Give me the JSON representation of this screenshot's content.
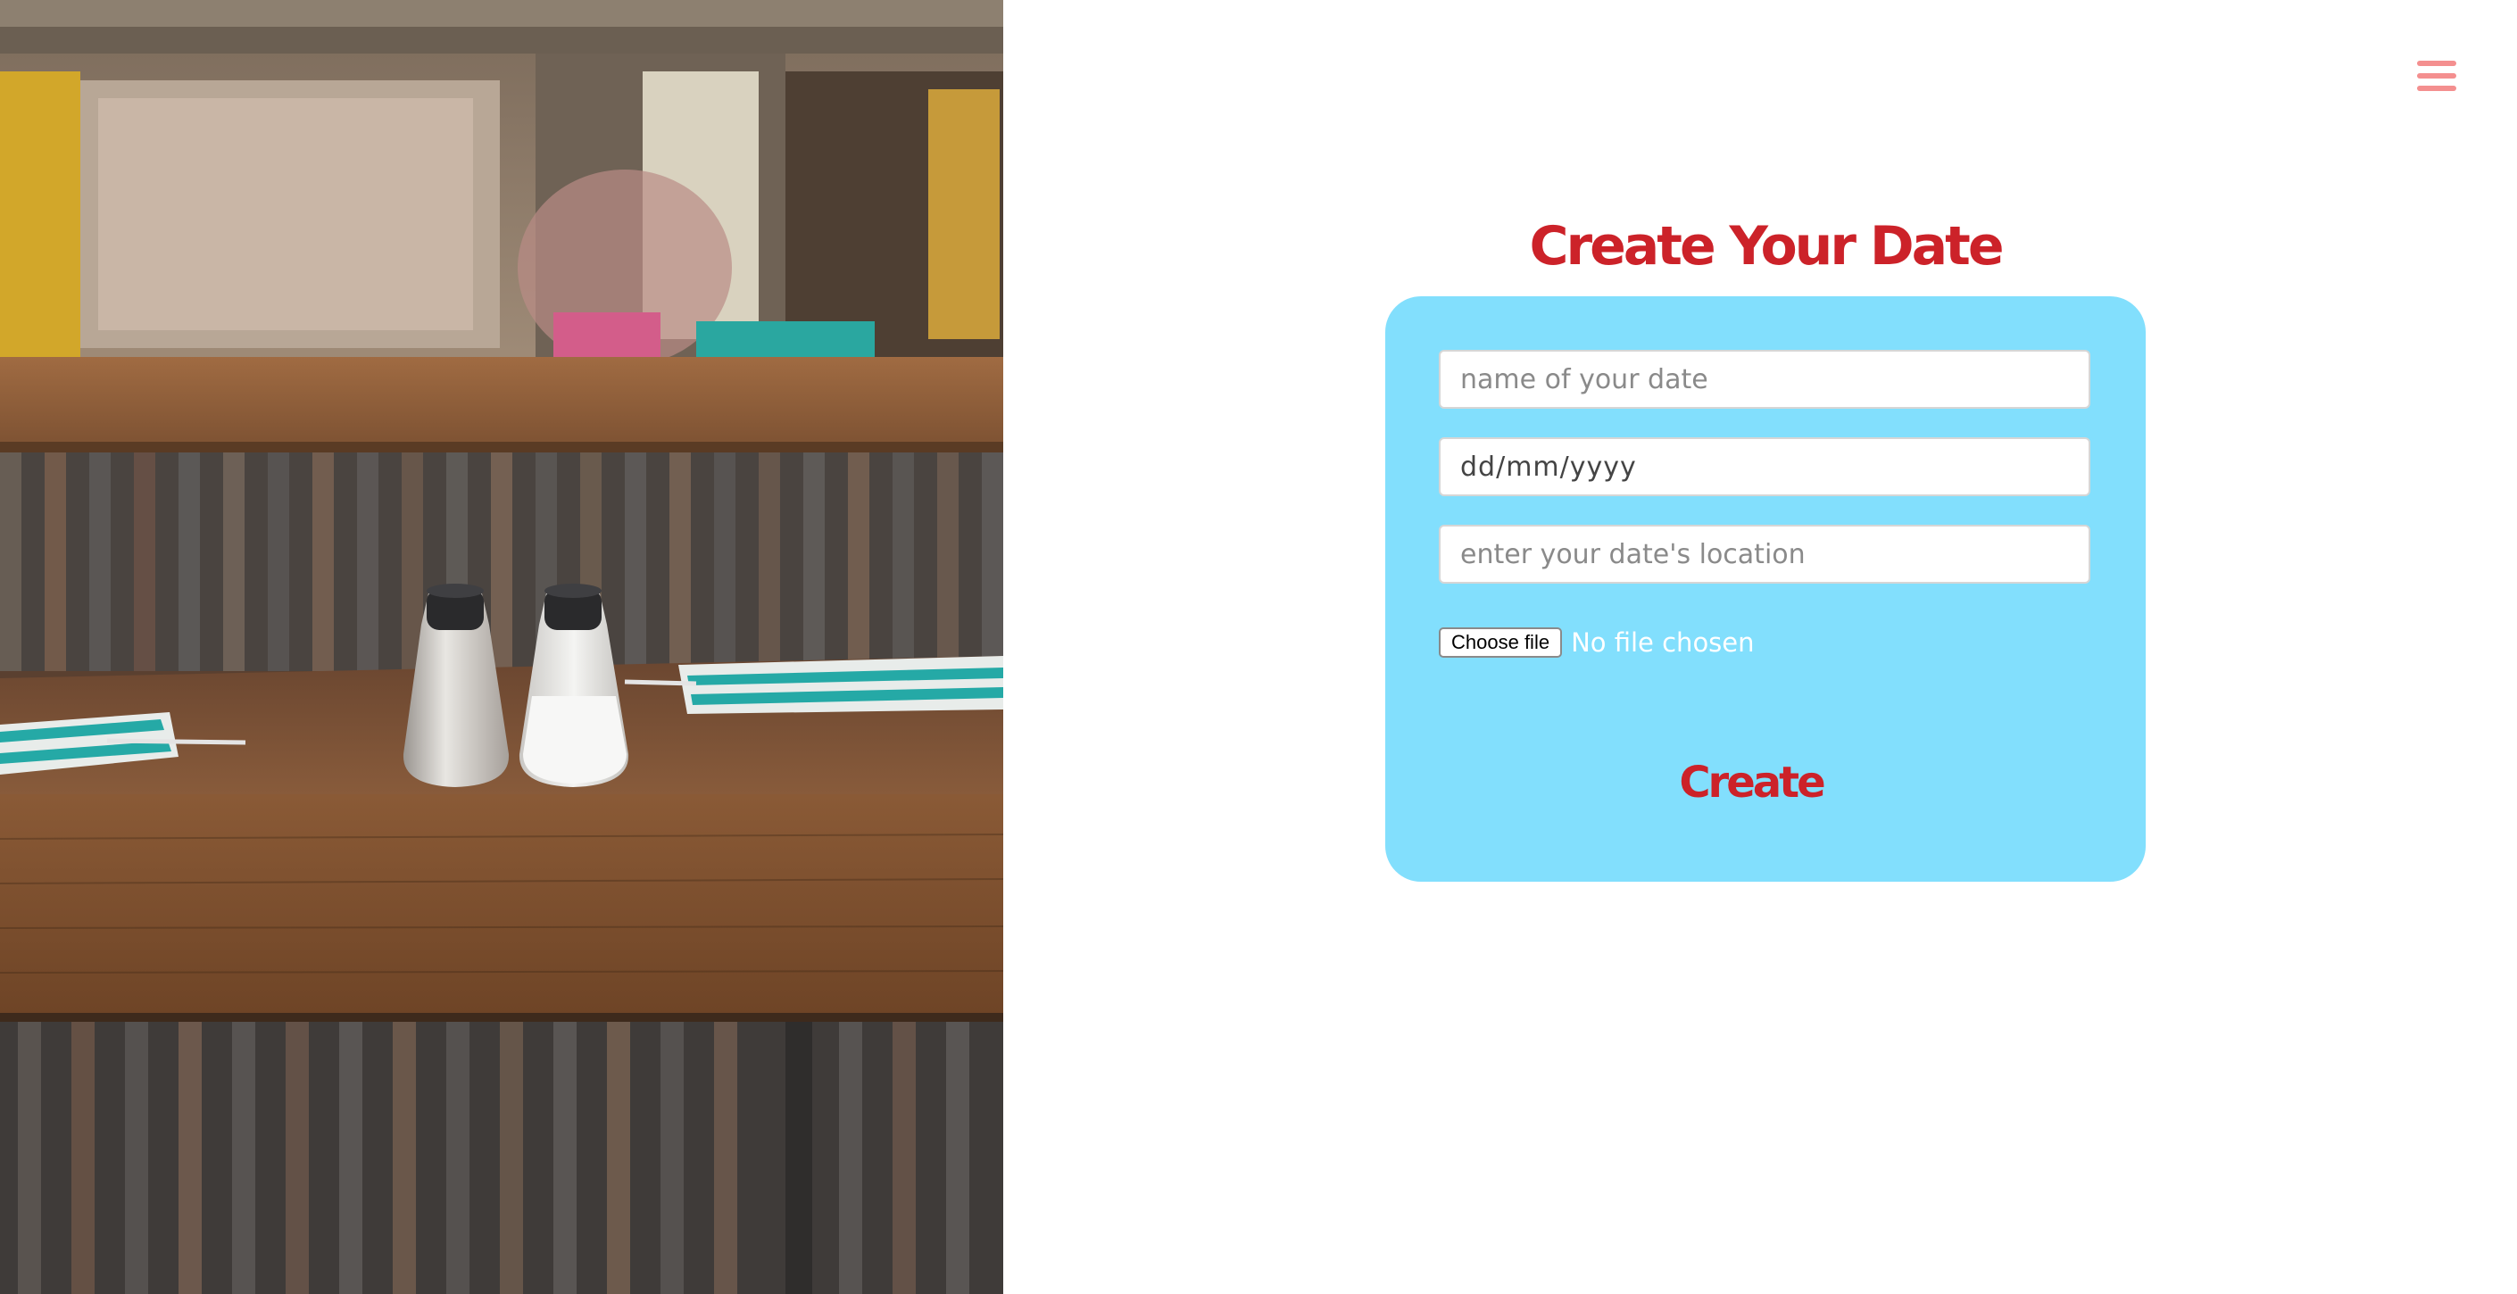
{
  "form": {
    "title": "Create Your Date",
    "name_placeholder": "name of your date",
    "date_placeholder": "dd/mm/yyyy",
    "location_placeholder": "enter your date's location",
    "file_button_label": "Choose file",
    "file_status": "No file chosen",
    "submit_label": "Create"
  },
  "header": {
    "menu_icon": "hamburger-menu-icon"
  },
  "colors": {
    "accent_red": "#cc2229",
    "card_blue": "#82dffd",
    "menu_pink": "#f48f8f"
  }
}
